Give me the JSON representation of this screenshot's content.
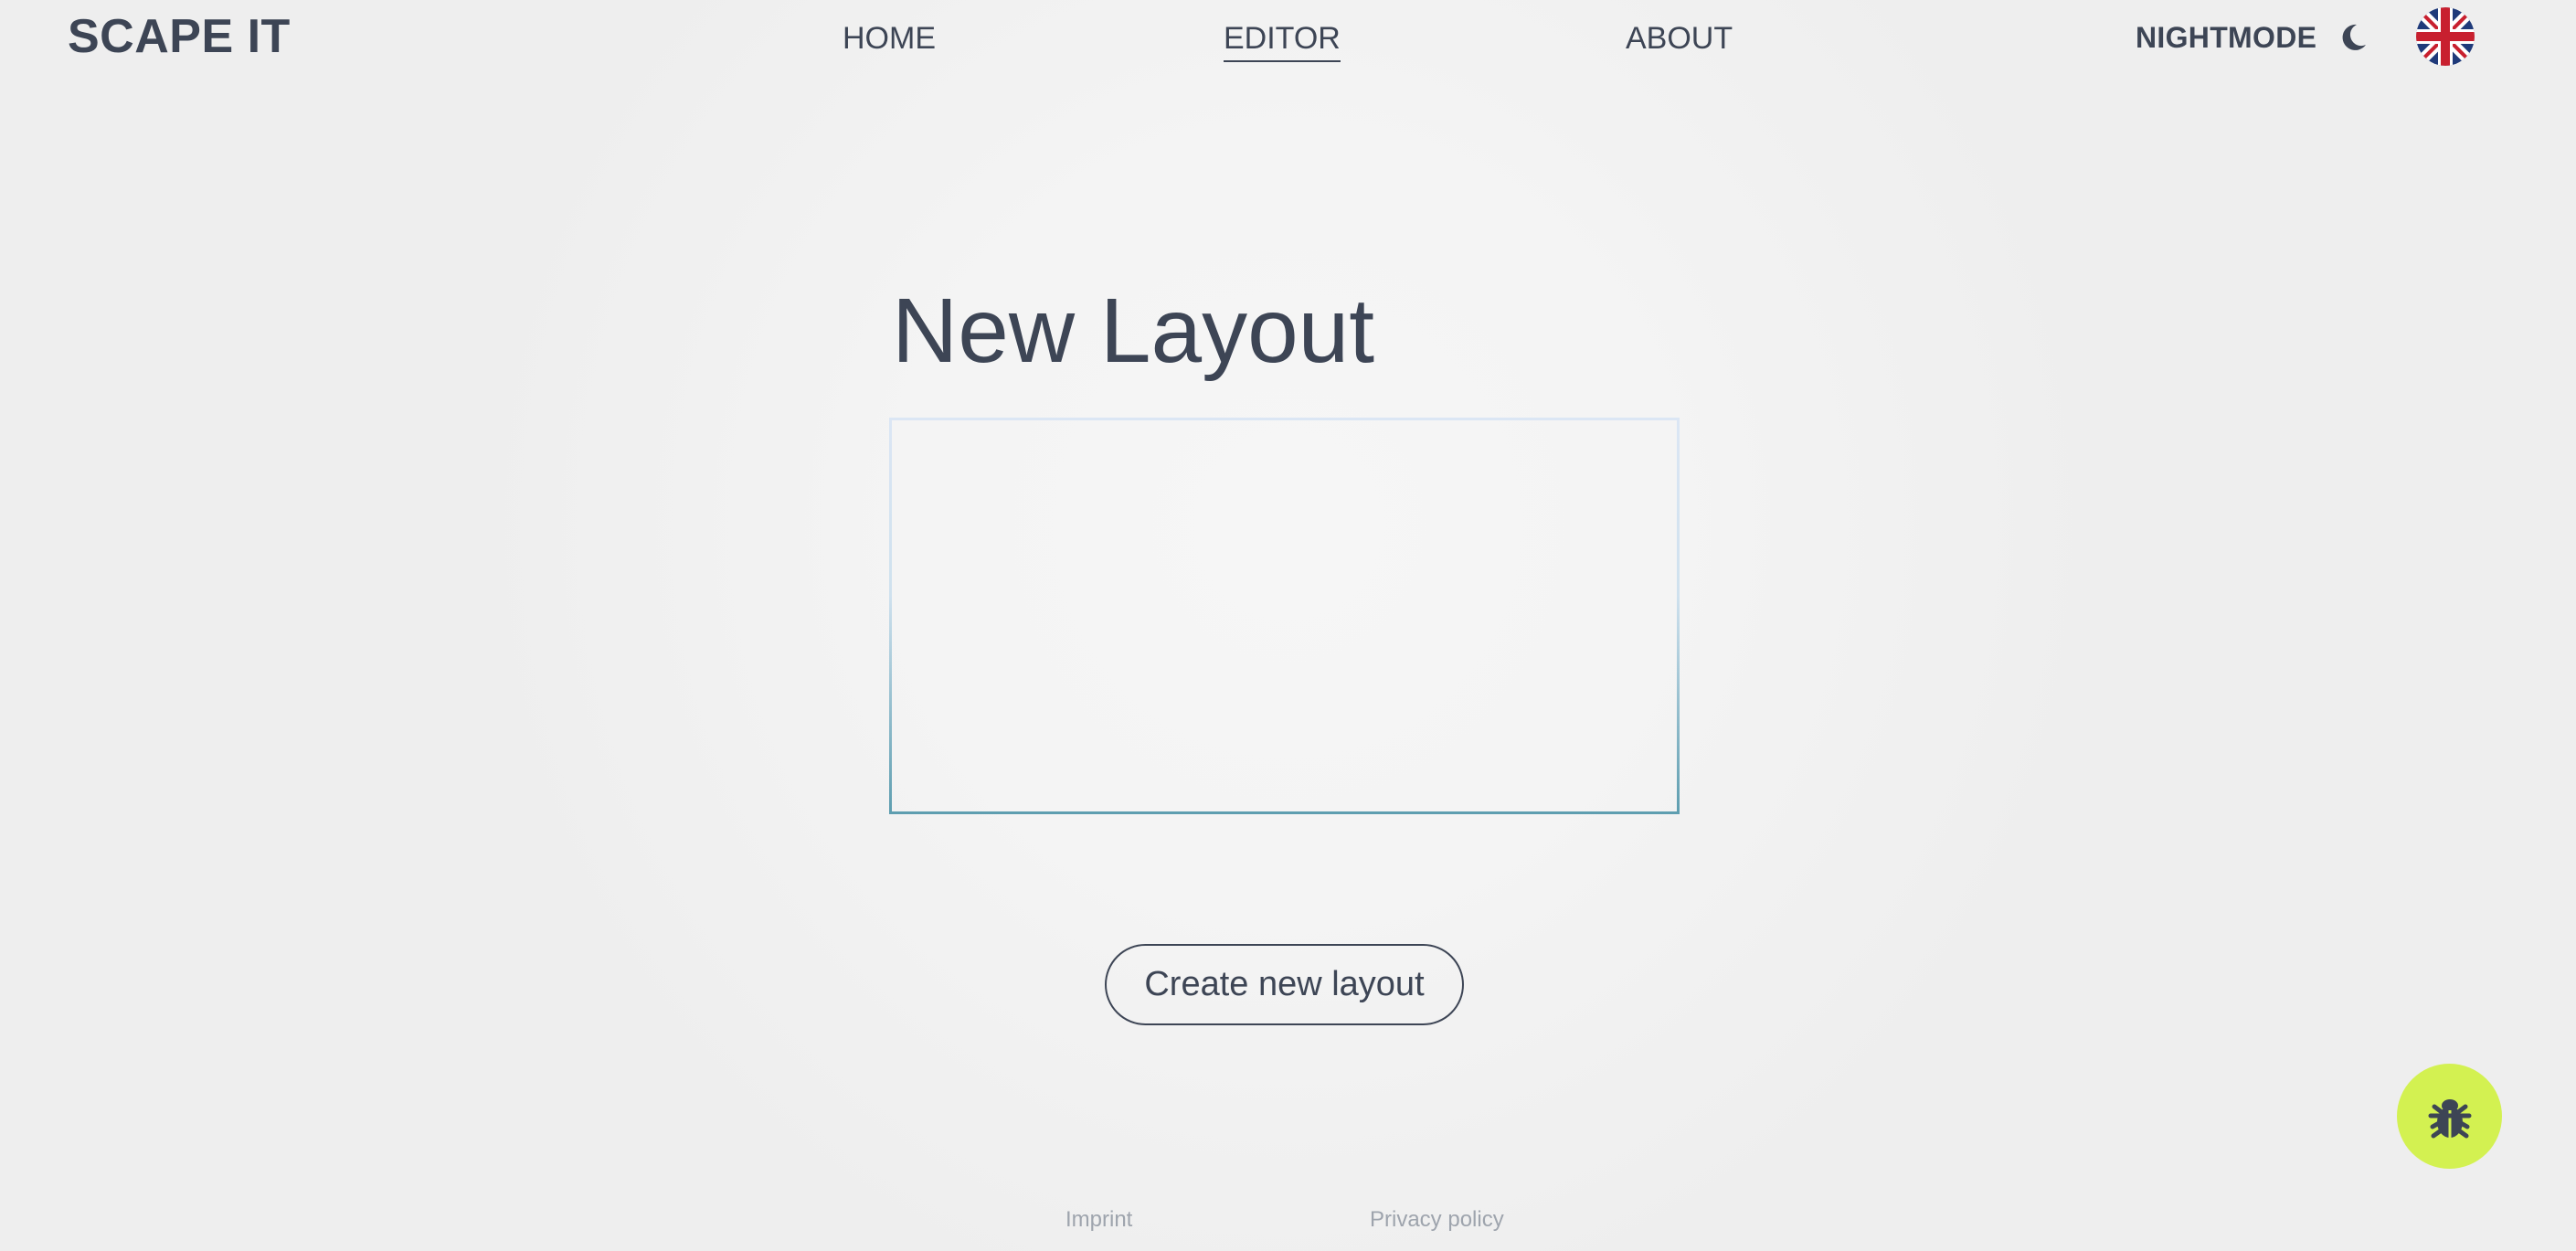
{
  "header": {
    "logo": "SCAPE IT",
    "nav": [
      {
        "label": "HOME",
        "active": false
      },
      {
        "label": "EDITOR",
        "active": true
      },
      {
        "label": "ABOUT",
        "active": false
      }
    ],
    "nightmode_label": "NIGHTMODE",
    "nightmode_icon": "moon-icon",
    "language_icon": "uk-flag-icon"
  },
  "main": {
    "title": "New Layout",
    "layout_input": {
      "value": "",
      "placeholder": ""
    },
    "create_button_label": "Create new layout"
  },
  "footer": {
    "imprint": "Imprint",
    "privacy": "Privacy policy"
  },
  "bug_report_icon": "bug-icon",
  "colors": {
    "text": "#3d4555",
    "bug_button": "#d3f151",
    "footer_text": "#9ea4ad",
    "box_border_top": "#dbe6f4",
    "box_border_bottom": "#5e9eb0"
  }
}
